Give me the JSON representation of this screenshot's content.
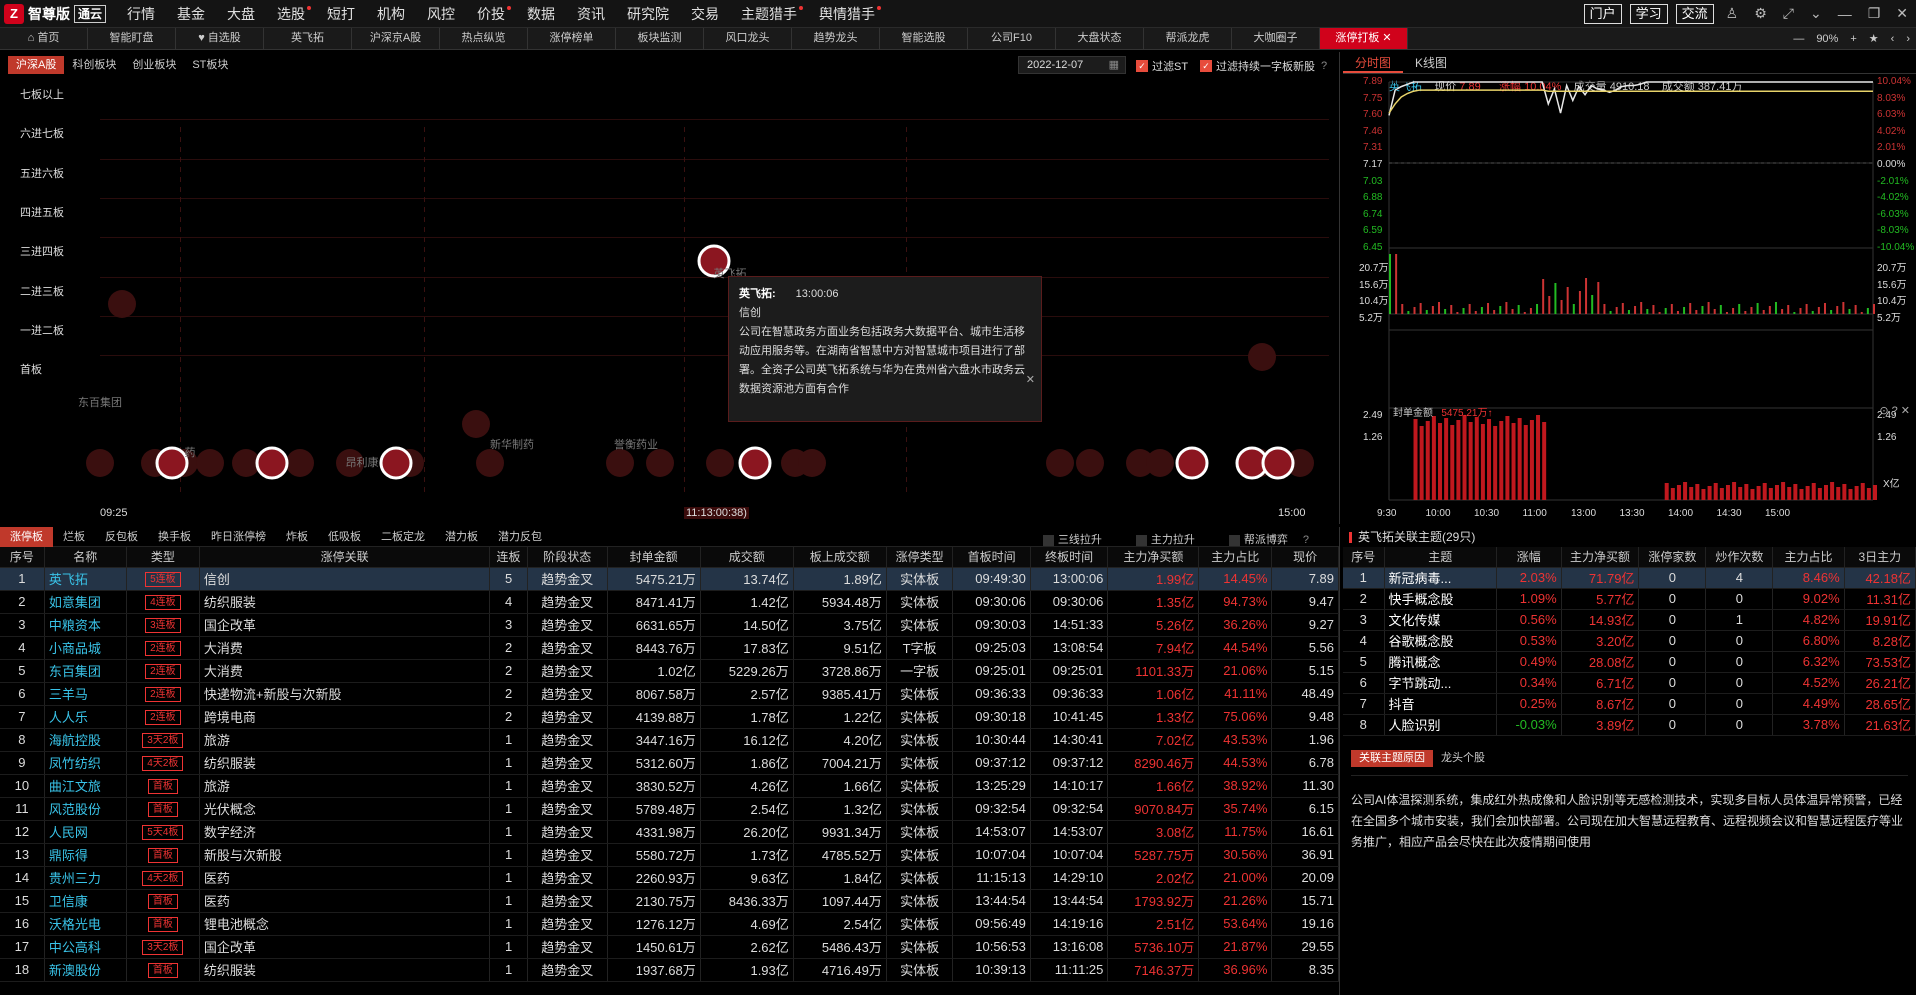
{
  "app": {
    "name": "智尊版",
    "edition": "通云"
  },
  "menu": [
    {
      "label": "行情",
      "dot": false
    },
    {
      "label": "基金",
      "dot": false
    },
    {
      "label": "大盘",
      "dot": false
    },
    {
      "label": "选股",
      "dot": true
    },
    {
      "label": "短打",
      "dot": false
    },
    {
      "label": "机构",
      "dot": false
    },
    {
      "label": "风控",
      "dot": false
    },
    {
      "label": "价投",
      "dot": true
    },
    {
      "label": "数据",
      "dot": false
    },
    {
      "label": "资讯",
      "dot": false
    },
    {
      "label": "研究院",
      "dot": false
    },
    {
      "label": "交易",
      "dot": false
    },
    {
      "label": "主题猎手",
      "dot": true
    },
    {
      "label": "舆情猎手",
      "dot": true
    }
  ],
  "top_buttons": [
    "门户",
    "学习",
    "交流"
  ],
  "tabs": [
    "首页",
    "智能盯盘",
    "自选股",
    "英飞拓",
    "沪深京A股",
    "热点纵览",
    "涨停榜单",
    "板块监测",
    "风口龙头",
    "趋势龙头",
    "智能选股",
    "公司F10",
    "大盘状态",
    "帮派龙虎",
    "大咖圈子",
    "涨停打板"
  ],
  "tab_active_index": 15,
  "zoom": "90%",
  "board_tabs": [
    "沪深A股",
    "科创板块",
    "创业板块",
    "ST板块"
  ],
  "date": "2022-12-07",
  "filters": {
    "filter_st": "过滤ST",
    "filter_yizi": "过滤持续一字板新股"
  },
  "levels": [
    "七板以上",
    "六进七板",
    "五进六板",
    "四进五板",
    "三进四板",
    "二进三板",
    "一进二板",
    "首板"
  ],
  "x_axis": {
    "start": "09:25",
    "cursor": "11:13:00:38)",
    "end": "15:00"
  },
  "bubble_labels": [
    {
      "text": "东百集团"
    },
    {
      "text": "新华制药"
    },
    {
      "text": "誉衡药业"
    },
    {
      "text": "昂利康"
    },
    {
      "text": "药"
    },
    {
      "text": "英飞拓"
    }
  ],
  "tooltip": {
    "name": "英飞拓:",
    "time": "13:00:06",
    "theme": "信创",
    "desc": "公司在智慧政务方面业务包括政务大数据平台、城市生活移动应用服务等。在湖南省智慧中方对智慧城市项目进行了部署。全资子公司英飞拓系统与华为在贵州省六盘水市政务云数据资源池方面有合作"
  },
  "right_tabs": [
    "分时图",
    "K线图"
  ],
  "quote": {
    "name": "英飞拓",
    "price_label": "现价",
    "price": "7.89",
    "chg_label": "涨幅",
    "chg": "10.04%",
    "vol_label": "成交量",
    "vol": "4910.18",
    "amt_label": "成交额",
    "amt": "387.41万"
  },
  "price_axis_left": [
    "7.89",
    "7.75",
    "7.60",
    "7.46",
    "7.31",
    "7.17",
    "7.03",
    "6.88",
    "6.74",
    "6.59",
    "6.45"
  ],
  "price_axis_right": [
    "10.04%",
    "8.03%",
    "6.03%",
    "4.02%",
    "2.01%",
    "0.00%",
    "-2.01%",
    "-4.02%",
    "-6.03%",
    "-8.03%",
    "-10.04%"
  ],
  "vol_axis": [
    "20.7万",
    "15.6万",
    "10.4万",
    "5.2万"
  ],
  "seal": {
    "label": "封单金额",
    "value": "5475.21万"
  },
  "seal_axis": [
    "2.49",
    "1.26"
  ],
  "seal_unit": "X亿",
  "time_axis": [
    "9:30",
    "10:00",
    "10:30",
    "11:00",
    "13:00",
    "13:30",
    "14:00",
    "14:30",
    "15:00"
  ],
  "intraday": {
    "prev_close": 7.17,
    "price": [
      7.6,
      7.82,
      7.85,
      7.87,
      7.89,
      7.89,
      7.89,
      7.89,
      7.89,
      7.89,
      7.89,
      7.89,
      7.89,
      7.89,
      7.89,
      7.89,
      7.89,
      7.89,
      7.89,
      7.89,
      7.89,
      7.89,
      7.89,
      7.89,
      7.89,
      7.89,
      7.7,
      7.83,
      7.62,
      7.86,
      7.73,
      7.85,
      7.78,
      7.86,
      7.83,
      7.82,
      7.8,
      7.82,
      7.85,
      7.86,
      7.86,
      7.87,
      7.89,
      7.89,
      7.89,
      7.89,
      7.89,
      7.89,
      7.89,
      7.89,
      7.89,
      7.89,
      7.89,
      7.89,
      7.89,
      7.89,
      7.89,
      7.89,
      7.89,
      7.89,
      7.89,
      7.89,
      7.89,
      7.89,
      7.89,
      7.89,
      7.89,
      7.89,
      7.89,
      7.89,
      7.89,
      7.89,
      7.89,
      7.89,
      7.89,
      7.89,
      7.89,
      7.89,
      7.89,
      7.89
    ],
    "avg": [
      7.62,
      7.7,
      7.76,
      7.79,
      7.81,
      7.82,
      7.82,
      7.82,
      7.82,
      7.82,
      7.82,
      7.82,
      7.82,
      7.82,
      7.82,
      7.82,
      7.82,
      7.82,
      7.82,
      7.82,
      7.82,
      7.82,
      7.82,
      7.82,
      7.82,
      7.82,
      7.81,
      7.81,
      7.81,
      7.81,
      7.81,
      7.81,
      7.81,
      7.81,
      7.81,
      7.81,
      7.81,
      7.81,
      7.81,
      7.81,
      7.81,
      7.81,
      7.81,
      7.81,
      7.81,
      7.81,
      7.81,
      7.81,
      7.81,
      7.81,
      7.81,
      7.81,
      7.81,
      7.81,
      7.81,
      7.81,
      7.81,
      7.81,
      7.81,
      7.81,
      7.81,
      7.81,
      7.81,
      7.81,
      7.81,
      7.81,
      7.81,
      7.81,
      7.81,
      7.81,
      7.81,
      7.81,
      7.81,
      7.81,
      7.81,
      7.81,
      7.81,
      7.81,
      7.81,
      7.81
    ]
  },
  "list_tabs": [
    "涨停板",
    "烂板",
    "反包板",
    "换手板",
    "昨日涨停榜",
    "炸板",
    "低吸板",
    "二板定龙",
    "潜力板",
    "潜力反包"
  ],
  "list_checks": [
    "三线拉升",
    "主力拉升",
    "帮派博弈"
  ],
  "columns": [
    "序号",
    "名称",
    "类型",
    "涨停关联",
    "连板",
    "阶段状态",
    "封单金额",
    "成交额",
    "板上成交额",
    "涨停类型",
    "首板时间",
    "终板时间",
    "主力净买额",
    "主力占比",
    "现价"
  ],
  "rows": [
    [
      "1",
      "英飞拓",
      "5连板",
      "信创",
      "5",
      "趋势金叉",
      "5475.21万",
      "13.74亿",
      "1.89亿",
      "实体板",
      "09:49:30",
      "13:00:06",
      "1.99亿",
      "14.45%",
      "7.89"
    ],
    [
      "2",
      "如意集团",
      "4连板",
      "纺织服装",
      "4",
      "趋势金叉",
      "8471.41万",
      "1.42亿",
      "5934.48万",
      "实体板",
      "09:30:06",
      "09:30:06",
      "1.35亿",
      "94.73%",
      "9.47"
    ],
    [
      "3",
      "中粮资本",
      "3连板",
      "国企改革",
      "3",
      "趋势金叉",
      "6631.65万",
      "14.50亿",
      "3.75亿",
      "实体板",
      "09:30:03",
      "14:51:33",
      "5.26亿",
      "36.26%",
      "9.27"
    ],
    [
      "4",
      "小商品城",
      "2连板",
      "大消费",
      "2",
      "趋势金叉",
      "8443.76万",
      "17.83亿",
      "9.51亿",
      "T字板",
      "09:25:03",
      "13:08:54",
      "7.94亿",
      "44.54%",
      "5.56"
    ],
    [
      "5",
      "东百集团",
      "2连板",
      "大消费",
      "2",
      "趋势金叉",
      "1.02亿",
      "5229.26万",
      "3728.86万",
      "一字板",
      "09:25:01",
      "09:25:01",
      "1101.33万",
      "21.06%",
      "5.15"
    ],
    [
      "6",
      "三羊马",
      "2连板",
      "快递物流+新股与次新股",
      "2",
      "趋势金叉",
      "8067.58万",
      "2.57亿",
      "9385.41万",
      "实体板",
      "09:36:33",
      "09:36:33",
      "1.06亿",
      "41.11%",
      "48.49"
    ],
    [
      "7",
      "人人乐",
      "2连板",
      "跨境电商",
      "2",
      "趋势金叉",
      "4139.88万",
      "1.78亿",
      "1.22亿",
      "实体板",
      "09:30:18",
      "10:41:45",
      "1.33亿",
      "75.06%",
      "9.48"
    ],
    [
      "8",
      "海航控股",
      "3天2板",
      "旅游",
      "1",
      "趋势金叉",
      "3447.16万",
      "16.12亿",
      "4.20亿",
      "实体板",
      "10:30:44",
      "14:30:41",
      "7.02亿",
      "43.53%",
      "1.96"
    ],
    [
      "9",
      "凤竹纺织",
      "4天2板",
      "纺织服装",
      "1",
      "趋势金叉",
      "5312.60万",
      "1.86亿",
      "7004.21万",
      "实体板",
      "09:37:12",
      "09:37:12",
      "8290.46万",
      "44.53%",
      "6.78"
    ],
    [
      "10",
      "曲江文旅",
      "首板",
      "旅游",
      "1",
      "趋势金叉",
      "3830.52万",
      "4.26亿",
      "1.66亿",
      "实体板",
      "13:25:29",
      "14:10:17",
      "1.66亿",
      "38.92%",
      "11.30"
    ],
    [
      "11",
      "风范股份",
      "首板",
      "光伏概念",
      "1",
      "趋势金叉",
      "5789.48万",
      "2.54亿",
      "1.32亿",
      "实体板",
      "09:32:54",
      "09:32:54",
      "9070.84万",
      "35.74%",
      "6.15"
    ],
    [
      "12",
      "人民网",
      "5天4板",
      "数字经济",
      "1",
      "趋势金叉",
      "4331.98万",
      "26.20亿",
      "9931.34万",
      "实体板",
      "14:53:07",
      "14:53:07",
      "3.08亿",
      "11.75%",
      "16.61"
    ],
    [
      "13",
      "鼎际得",
      "首板",
      "新股与次新股",
      "1",
      "趋势金叉",
      "5580.72万",
      "1.73亿",
      "4785.52万",
      "实体板",
      "10:07:04",
      "10:07:04",
      "5287.75万",
      "30.56%",
      "36.91"
    ],
    [
      "14",
      "贵州三力",
      "4天2板",
      "医药",
      "1",
      "趋势金叉",
      "2260.93万",
      "9.63亿",
      "1.84亿",
      "实体板",
      "11:15:13",
      "14:29:10",
      "2.02亿",
      "21.00%",
      "20.09"
    ],
    [
      "15",
      "卫信康",
      "首板",
      "医药",
      "1",
      "趋势金叉",
      "2130.75万",
      "8436.33万",
      "1097.44万",
      "实体板",
      "13:44:54",
      "13:44:54",
      "1793.92万",
      "21.26%",
      "15.71"
    ],
    [
      "16",
      "沃格光电",
      "首板",
      "锂电池概念",
      "1",
      "趋势金叉",
      "1276.12万",
      "4.69亿",
      "2.54亿",
      "实体板",
      "09:56:49",
      "14:19:16",
      "2.51亿",
      "53.64%",
      "19.16"
    ],
    [
      "17",
      "中公高科",
      "3天2板",
      "国企改革",
      "1",
      "趋势金叉",
      "1450.61万",
      "2.62亿",
      "5486.43万",
      "实体板",
      "10:56:53",
      "13:16:08",
      "5736.10万",
      "21.87%",
      "29.55"
    ],
    [
      "18",
      "新澳股份",
      "首板",
      "纺织服装",
      "1",
      "趋势金叉",
      "1937.68万",
      "1.93亿",
      "4716.49万",
      "实体板",
      "10:39:13",
      "11:11:25",
      "7146.37万",
      "36.96%",
      "8.35"
    ]
  ],
  "themes_title": "英飞拓关联主题(29只)",
  "theme_columns": [
    "序号",
    "主题",
    "涨幅",
    "主力净买额",
    "涨停家数",
    "炒作次数",
    "主力占比",
    "3日主力"
  ],
  "themes": [
    [
      "1",
      "新冠病毒...",
      "2.03%",
      "71.79亿",
      "0",
      "4",
      "8.46%",
      "42.18亿"
    ],
    [
      "2",
      "快手概念股",
      "1.09%",
      "5.77亿",
      "0",
      "0",
      "9.02%",
      "11.31亿"
    ],
    [
      "3",
      "文化传媒",
      "0.56%",
      "14.93亿",
      "0",
      "1",
      "4.82%",
      "19.91亿"
    ],
    [
      "4",
      "谷歌概念股",
      "0.53%",
      "3.20亿",
      "0",
      "0",
      "6.80%",
      "8.28亿"
    ],
    [
      "5",
      "腾讯概念",
      "0.49%",
      "28.08亿",
      "0",
      "0",
      "6.32%",
      "73.53亿"
    ],
    [
      "6",
      "字节跳动...",
      "0.34%",
      "6.71亿",
      "0",
      "0",
      "4.52%",
      "26.21亿"
    ],
    [
      "7",
      "抖音",
      "0.25%",
      "8.67亿",
      "0",
      "0",
      "4.49%",
      "28.65亿"
    ],
    [
      "8",
      "人脸识别",
      "-0.03%",
      "3.89亿",
      "0",
      "0",
      "3.78%",
      "21.63亿"
    ]
  ],
  "reason_tabs": [
    "关联主题原因",
    "龙头个股"
  ],
  "reason_text": "公司AI体温探测系统，集成红外热成像和人脸识别等无感检测技术，实现多目标人员体温异常预警，已经在全国多个城市安装，我们会加快部署。公司现在加大智慧远程教育、远程视频会议和智慧远程医疗等业务推广，相应产品会尽快在此次疫情期间使用",
  "colors": {
    "accent": "#d0021b",
    "up": "#ee3333",
    "down": "#22bb22",
    "name": "#39c3e8",
    "selected_row": "#243447"
  }
}
